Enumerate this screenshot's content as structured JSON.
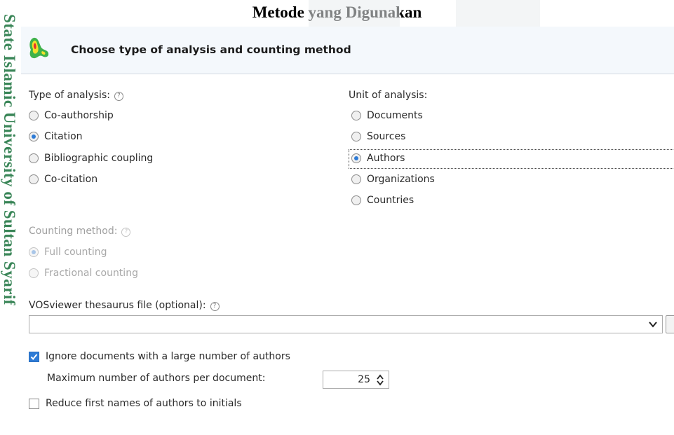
{
  "document": {
    "title": "Metode yang Digunakan",
    "watermark": "State Islamic University of Sultan Syarif"
  },
  "dialog": {
    "icon": "vosviewer-heatmap-icon",
    "header_title": "Choose type of analysis and counting method",
    "type_of_analysis": {
      "label": "Type of analysis:",
      "options": [
        {
          "label": "Co-authorship",
          "checked": false
        },
        {
          "label": "Citation",
          "checked": true
        },
        {
          "label": "Bibliographic coupling",
          "checked": false
        },
        {
          "label": "Co-citation",
          "checked": false
        }
      ]
    },
    "unit_of_analysis": {
      "label": "Unit of analysis:",
      "options": [
        {
          "label": "Documents",
          "checked": false
        },
        {
          "label": "Sources",
          "checked": false
        },
        {
          "label": "Authors",
          "checked": true
        },
        {
          "label": "Organizations",
          "checked": false
        },
        {
          "label": "Countries",
          "checked": false
        }
      ]
    },
    "counting_method": {
      "label": "Counting method:",
      "disabled": true,
      "options": [
        {
          "label": "Full counting",
          "checked": true
        },
        {
          "label": "Fractional counting",
          "checked": false
        }
      ]
    },
    "thesaurus": {
      "label": "VOSviewer thesaurus file (optional):",
      "value": "",
      "browse_label": "..."
    },
    "ignore_large": {
      "label": "Ignore documents with a large number of authors",
      "checked": true
    },
    "max_authors": {
      "label": "Maximum number of authors per document:",
      "value": "25"
    },
    "reduce_first_names": {
      "label": "Reduce first names of authors to initials",
      "checked": false
    },
    "help_glyph": "?"
  },
  "colors": {
    "accent": "#2e7bd6",
    "watermark": "#2f7f4f",
    "header_bg": "#f4f8fc"
  }
}
